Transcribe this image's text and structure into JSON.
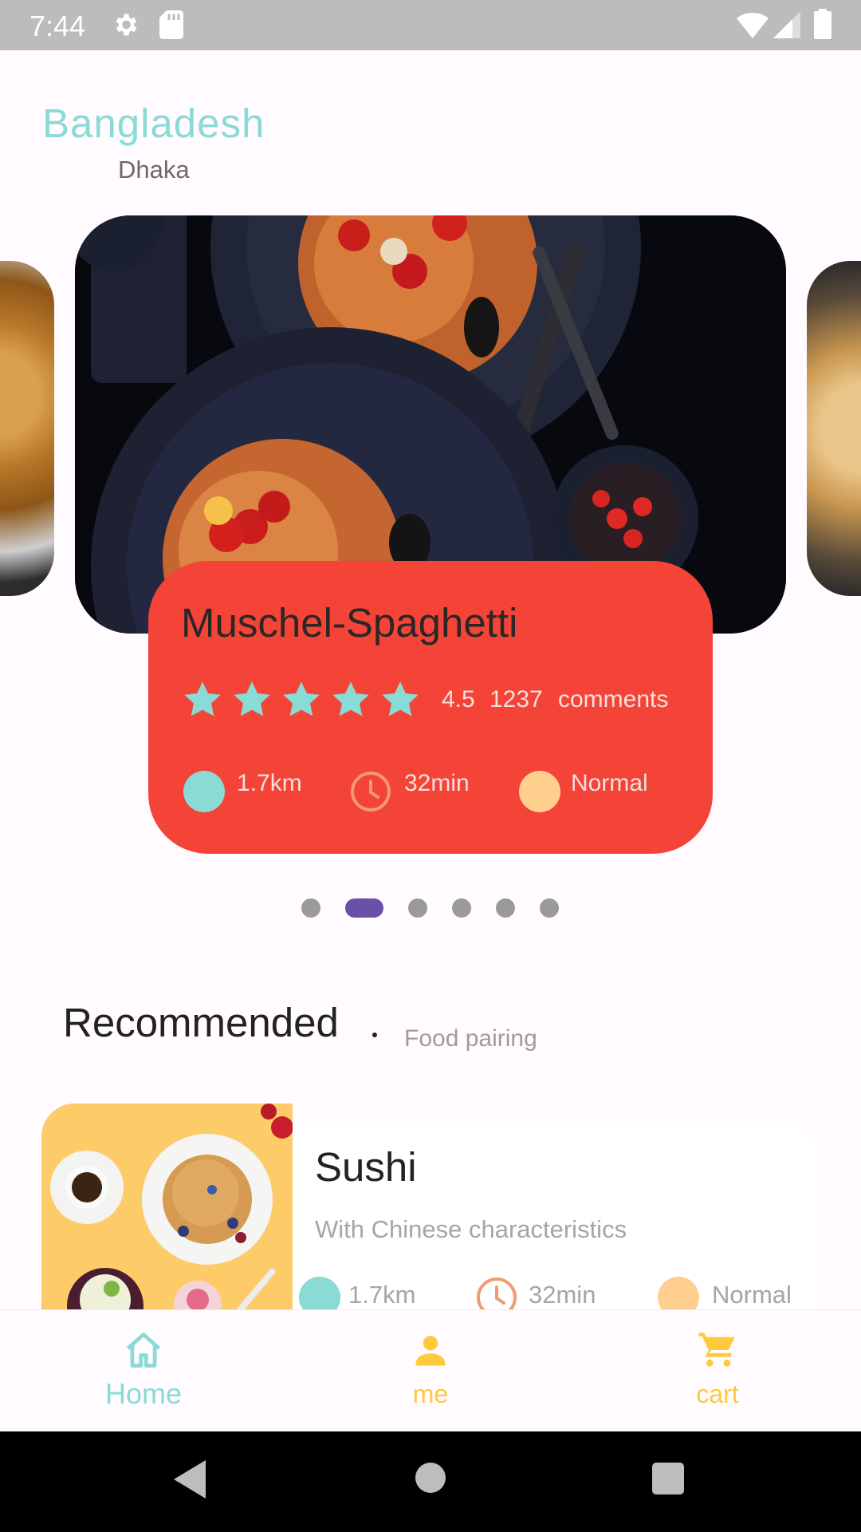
{
  "status_bar": {
    "time": "7:44",
    "icons": [
      "gear-icon",
      "sd-card-icon",
      "wifi-icon",
      "cell-signal-icon",
      "battery-icon"
    ]
  },
  "location": {
    "country": "Bangladesh",
    "city": "Dhaka"
  },
  "featured": {
    "title": "Muschel-Spaghetti",
    "rating": "4.5",
    "comments_count": "1237",
    "comments_label": "comments",
    "stars": 5,
    "distance": "1.7km",
    "time": "32min",
    "level": "Normal",
    "card_color": "#F44437"
  },
  "carousel": {
    "pages": 6,
    "active_index": 1
  },
  "recommended": {
    "title": "Recommended",
    "separator": ".",
    "subtitle": "Food pairing",
    "items": [
      {
        "name": "Sushi",
        "description": "With Chinese characteristics",
        "distance": "1.7km",
        "time": "32min",
        "level": "Normal"
      }
    ]
  },
  "bottom_nav": {
    "items": [
      {
        "label": "Home",
        "icon": "home-icon",
        "color": "#8ADAD5"
      },
      {
        "label": "me",
        "icon": "person-icon",
        "color": "#FFC93C"
      },
      {
        "label": "cart",
        "icon": "cart-icon",
        "color": "#FFC93C"
      }
    ]
  },
  "colors": {
    "teal": "#8ADAD5",
    "peach": "#FFCF90",
    "accent_purple": "#6A50A8",
    "clock_orange": "#F29A74"
  }
}
